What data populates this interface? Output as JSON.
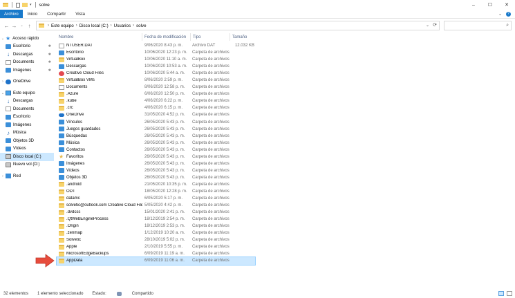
{
  "window": {
    "title": "solve"
  },
  "ribbon": {
    "tabs": [
      "Archivo",
      "Inicio",
      "Compartir",
      "Vista"
    ]
  },
  "address": {
    "crumbs": [
      "Este equipo",
      "Disco local (C:)",
      "Usuarios",
      "solve"
    ]
  },
  "columns": {
    "name": "Nombre",
    "date": "Fecha de modificación",
    "type": "Tipo",
    "size": "Tamaño"
  },
  "nav": {
    "quick_access": "Acceso rápido",
    "quick_items": [
      "Escritorio",
      "Descargas",
      "Documents",
      "Imágenes"
    ],
    "onedrive": "OneDrive",
    "this_pc": "Este equipo",
    "pc_items": [
      "Descargas",
      "Documents",
      "Escritorio",
      "Imágenes",
      "Música",
      "Objetos 3D",
      "Vídeos",
      "Disco local (C:)",
      "Nuevo vol (D:)"
    ],
    "network": "Red"
  },
  "files": [
    {
      "name": "NTUSER.DAT",
      "date": "9/06/2020 8:43 p. m.",
      "type": "Archivo DAT",
      "size": "12.032 KB",
      "icon": "doc"
    },
    {
      "name": "Escritorio",
      "date": "10/06/2020 12:23 p. m.",
      "type": "Carpeta de archivos",
      "size": "",
      "icon": "blue"
    },
    {
      "name": "VirtualBox",
      "date": "10/06/2020 11:10 a. m.",
      "type": "Carpeta de archivos",
      "size": "",
      "icon": "folder"
    },
    {
      "name": "Descargas",
      "date": "10/06/2020 10:53 a. m.",
      "type": "Carpeta de archivos",
      "size": "",
      "icon": "blue"
    },
    {
      "name": "Creative Cloud Files",
      "date": "10/06/2020 5:44 a. m.",
      "type": "Carpeta de archivos",
      "size": "",
      "icon": "cc"
    },
    {
      "name": "VirtualBox VMs",
      "date": "8/06/2020 2:59 p. m.",
      "type": "Carpeta de archivos",
      "size": "",
      "icon": "folder"
    },
    {
      "name": "Documents",
      "date": "8/06/2020 12:58 p. m.",
      "type": "Carpeta de archivos",
      "size": "",
      "icon": "doc"
    },
    {
      "name": ".Azure",
      "date": "6/06/2020 12:50 p. m.",
      "type": "Carpeta de archivos",
      "size": "",
      "icon": "folder"
    },
    {
      "name": ".kube",
      "date": "4/06/2020 6:22 p. m.",
      "type": "Carpeta de archivos",
      "size": "",
      "icon": "folder"
    },
    {
      "name": ".crc",
      "date": "4/06/2020 6:15 p. m.",
      "type": "Carpeta de archivos",
      "size": "",
      "icon": "folder"
    },
    {
      "name": "OneDrive",
      "date": "31/05/2020 4:52 p. m.",
      "type": "Carpeta de archivos",
      "size": "",
      "icon": "cloud"
    },
    {
      "name": "Vínculos",
      "date": "26/05/2020 5:43 p. m.",
      "type": "Carpeta de archivos",
      "size": "",
      "icon": "blue"
    },
    {
      "name": "Juegos guardados",
      "date": "26/05/2020 5:43 p. m.",
      "type": "Carpeta de archivos",
      "size": "",
      "icon": "blue"
    },
    {
      "name": "Búsquedas",
      "date": "26/05/2020 5:43 p. m.",
      "type": "Carpeta de archivos",
      "size": "",
      "icon": "blue"
    },
    {
      "name": "Música",
      "date": "26/05/2020 5:43 p. m.",
      "type": "Carpeta de archivos",
      "size": "",
      "icon": "blue"
    },
    {
      "name": "Contactos",
      "date": "26/05/2020 5:43 p. m.",
      "type": "Carpeta de archivos",
      "size": "",
      "icon": "blue"
    },
    {
      "name": "Favoritos",
      "date": "26/05/2020 5:43 p. m.",
      "type": "Carpeta de archivos",
      "size": "",
      "icon": "star"
    },
    {
      "name": "Imágenes",
      "date": "26/05/2020 5:43 p. m.",
      "type": "Carpeta de archivos",
      "size": "",
      "icon": "blue"
    },
    {
      "name": "Vídeos",
      "date": "26/05/2020 5:43 p. m.",
      "type": "Carpeta de archivos",
      "size": "",
      "icon": "blue"
    },
    {
      "name": "Objetos 3D",
      "date": "26/05/2020 5:43 p. m.",
      "type": "Carpeta de archivos",
      "size": "",
      "icon": "blue"
    },
    {
      "name": ".android",
      "date": "21/05/2020 10:35 p. m.",
      "type": "Carpeta de archivos",
      "size": "",
      "icon": "folder"
    },
    {
      "name": "ODT",
      "date": "18/05/2020 12:28 p. m.",
      "type": "Carpeta de archivos",
      "size": "",
      "icon": "folder"
    },
    {
      "name": "datamc",
      "date": "6/05/2020 5:17 p. m.",
      "type": "Carpeta de archivos",
      "size": "",
      "icon": "folder"
    },
    {
      "name": "solvetic@outlook.com Creative Cloud Files",
      "date": "5/05/2020 4:42 p. m.",
      "type": "Carpeta de archivos",
      "size": "",
      "icon": "folder"
    },
    {
      "name": ".dvdcss",
      "date": "15/01/2020 2:41 p. m.",
      "type": "Carpeta de archivos",
      "size": "",
      "icon": "folder"
    },
    {
      "name": ".QtWebEngineProcess",
      "date": "18/12/2019 2:54 p. m.",
      "type": "Carpeta de archivos",
      "size": "",
      "icon": "folder"
    },
    {
      "name": ".Origin",
      "date": "18/12/2019 2:53 p. m.",
      "type": "Carpeta de archivos",
      "size": "",
      "icon": "folder"
    },
    {
      "name": ".zenmap",
      "date": "1/12/2019 10:20 a. m.",
      "type": "Carpeta de archivos",
      "size": "",
      "icon": "folder"
    },
    {
      "name": "Solvetic",
      "date": "28/10/2019 5:02 p. m.",
      "type": "Carpeta de archivos",
      "size": "",
      "icon": "folder"
    },
    {
      "name": "Apple",
      "date": "2/10/2019 5:55 p. m.",
      "type": "Carpeta de archivos",
      "size": "",
      "icon": "folder"
    },
    {
      "name": "MicrosoftEdgeBackups",
      "date": "6/09/2019 11:19 a. m.",
      "type": "Carpeta de archivos",
      "size": "",
      "icon": "folder"
    },
    {
      "name": "AppData",
      "date": "6/09/2019 11:06 a. m.",
      "type": "Carpeta de archivos",
      "size": "",
      "icon": "folder",
      "selected": true
    }
  ],
  "status": {
    "count": "32 elementos",
    "selected": "1 elemento seleccionado",
    "state_label": "Estado:",
    "state_value": "Compartido"
  },
  "colors": {
    "accent": "#1979ca",
    "selection": "#cce8ff",
    "arrow": "#e74c3c"
  }
}
